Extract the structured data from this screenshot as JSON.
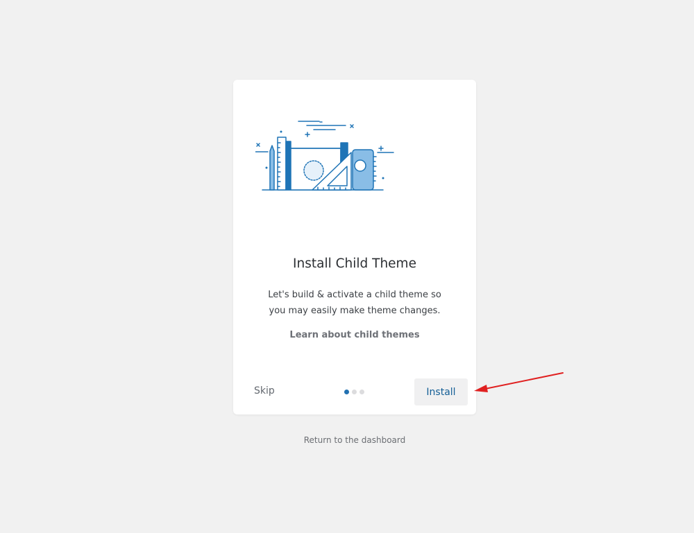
{
  "wizard": {
    "title": "Install Child Theme",
    "description": "Let's build & activate a child theme so you may easily make theme changes.",
    "learn_link": "Learn about child themes",
    "skip_label": "Skip",
    "install_label": "Install",
    "steps_total": 3,
    "current_step": 1
  },
  "footer": {
    "return_link": "Return to the dashboard"
  },
  "colors": {
    "accent": "#2271b1",
    "illustration_stroke": "#1f74b6",
    "illustration_fill": "#89bde6",
    "annotation_arrow": "#e02020"
  },
  "icons": {
    "illustration": "design-tools-illustration",
    "annotation": "red-arrow-annotation"
  }
}
